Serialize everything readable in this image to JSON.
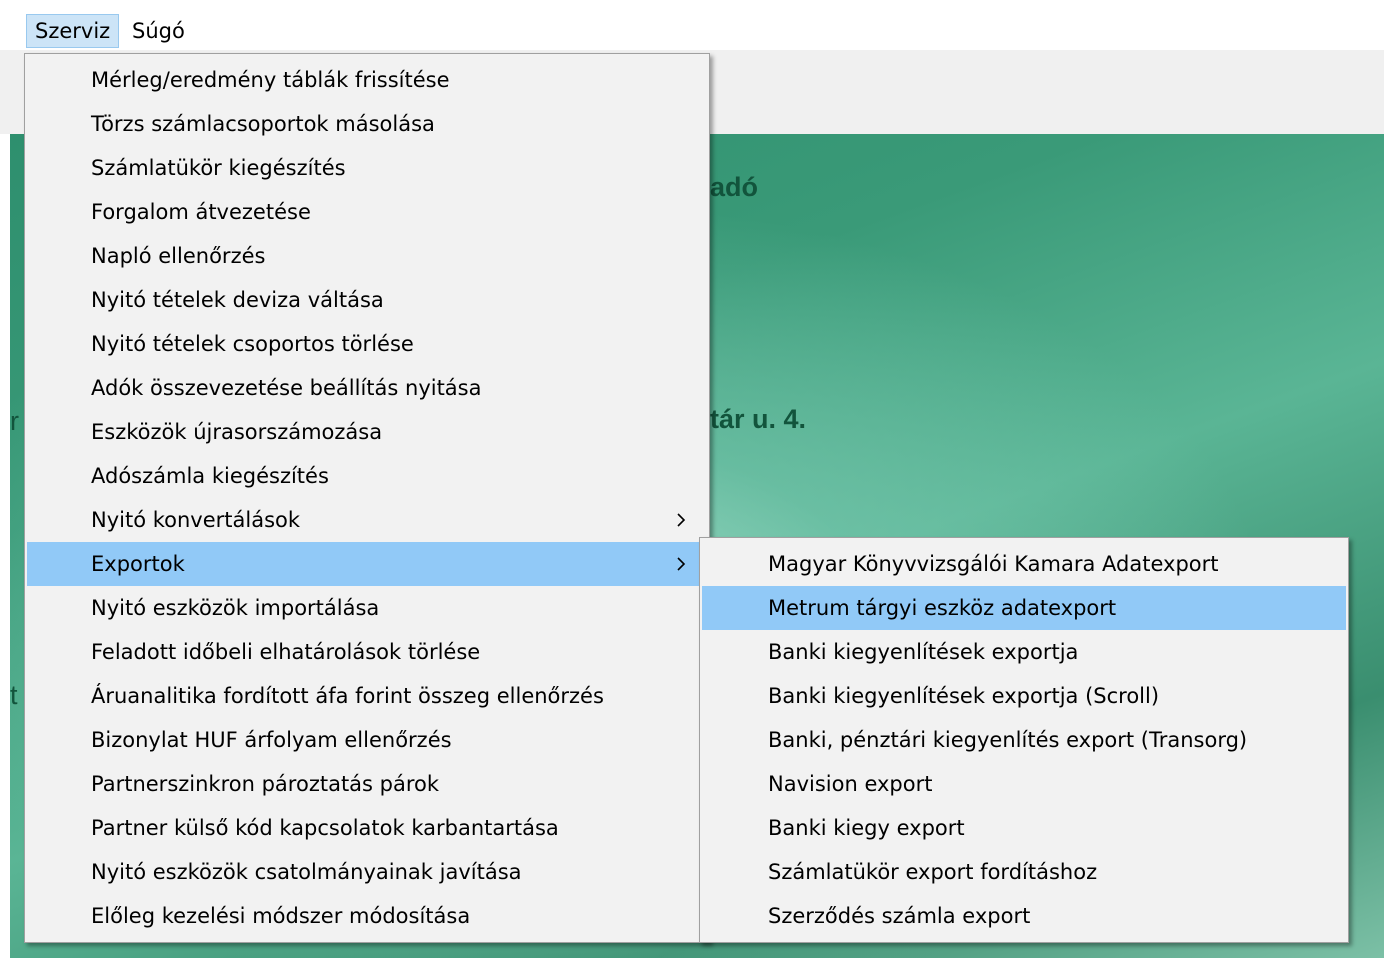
{
  "menubar": {
    "items": [
      {
        "label": "Szerviz"
      },
      {
        "label": "Súgó"
      }
    ]
  },
  "background": {
    "fragments": [
      "adó",
      "tár u. 4.",
      "r",
      "t"
    ]
  },
  "main_menu": {
    "items": [
      {
        "label": "Mérleg/eredmény táblák frissítése"
      },
      {
        "label": "Törzs számlacsoportok másolása"
      },
      {
        "label": "Számlatükör kiegészítés"
      },
      {
        "label": "Forgalom átvezetése"
      },
      {
        "label": "Napló ellenőrzés"
      },
      {
        "label": "Nyitó tételek deviza váltása"
      },
      {
        "label": "Nyitó tételek csoportos törlése"
      },
      {
        "label": "Adók összevezetése beállítás nyitása"
      },
      {
        "label": "Eszközök újrasorszámozása"
      },
      {
        "label": "Adószámla kiegészítés"
      },
      {
        "label": "Nyitó konvertálások"
      },
      {
        "label": "Exportok"
      },
      {
        "label": "Nyitó eszközök importálása"
      },
      {
        "label": "Feladott időbeli elhatárolások törlése"
      },
      {
        "label": "Áruanalitika fordított áfa forint összeg ellenőrzés"
      },
      {
        "label": "Bizonylat HUF árfolyam ellenőrzés"
      },
      {
        "label": "Partnerszinkron pároztatás párok"
      },
      {
        "label": "Partner külső kód kapcsolatok karbantartása"
      },
      {
        "label": "Nyitó eszközök csatolmányainak javítása"
      },
      {
        "label": "Előleg kezelési módszer módosítása"
      }
    ]
  },
  "export_submenu": {
    "items": [
      {
        "label": "Magyar Könyvvizsgálói Kamara Adatexport"
      },
      {
        "label": "Metrum tárgyi eszköz adatexport"
      },
      {
        "label": "Banki kiegyenlítések exportja"
      },
      {
        "label": "Banki kiegyenlítések exportja (Scroll)"
      },
      {
        "label": "Banki, pénztári kiegyenlítés export (Transorg)"
      },
      {
        "label": "Navision export"
      },
      {
        "label": "Banki kiegy export"
      },
      {
        "label": "Számlatükör export fordításhoz"
      },
      {
        "label": "Szerződés számla export"
      }
    ]
  },
  "colors": {
    "highlight": "#91c9f7",
    "menu_background": "#f2f2f2",
    "menubar_active": "#cce4f7",
    "background_green": "#3a9a78"
  },
  "icons": {
    "submenu_arrow": "chevron-right-icon"
  }
}
